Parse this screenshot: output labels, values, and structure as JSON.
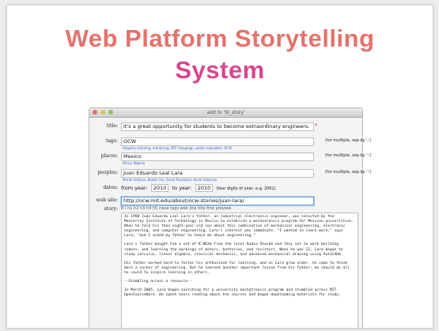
{
  "slide": {
    "title_line1": "Web Platform Storytelling",
    "title_line2": "System"
  },
  "window": {
    "title": "add to 'bl_story'"
  },
  "form": {
    "title": {
      "label": "title:",
      "value": "It's a great opportunity for students to become extraordinary engineers.",
      "required": "*"
    },
    "tags": {
      "label": "tags:",
      "value": "OCW",
      "hint": "Adaptive learning, mentoring, MIT Campaign, public education, OCW",
      "note": "(for multiple, sep by ';')"
    },
    "places": {
      "label": "places:",
      "value": "Mexico",
      "hint": "Africa, Nigeria",
      "note": "(for multiple, sep by ';')"
    },
    "peoples": {
      "label": "peoples:",
      "value": "Juan Eduardo Leal Lara",
      "hint": "Muriel Ambrus, Baldor rox, Sarah Randazzo, Kunle Adejumo",
      "note": "(for multiple, sep by ';')"
    },
    "dates": {
      "label": "dates:",
      "from_label": "from year:",
      "from": "2010",
      "to_label": "to year:",
      "to": "2010",
      "format": "(four digits of year, e.g. 2001)"
    },
    "website": {
      "label": "web site:",
      "value": "http://ocw.mit.edu/about/ocw-stories/juan-lara/"
    },
    "story": {
      "label": "story:",
      "toolbar": "B   I   h1   h2   h3   h4   h5   close tags   web   link   title   first   preview",
      "paragraphs": [
        "In 1990 Juan Eduardo Leal Lara's father, an industrial electronics engineer, was selected by the Monterrey Institute of Technology in Mexico to establish a mechatronics program for Mexican universities. When he told his then eight-year-old son about this combination of mechanical engineering, electronic engineering, and computer engineering, Lara's interest was immediate. \"I wanted to learn more,\" says Lara, \"and I asked my father to teach me about engineering.\"",
        "Lara's father bought him a set of K'NEX® from the local Radio Shack® and they set to work building robots, and learning the workings of motors, batteries, and resistors. When he was 12, Lara began to study calculus, linear algebra, classical mechanics, and advanced mechanical drawing using AutoCAD®.",
        "His father worked hard to foster his enthusiasm for learning, and as Lara grew older, he came to think more a career of engineering. But he learned another important lesson from his father: he should do all he could to inspire learning in others.",
        "--Stumbling across a resource--",
        "In March 2005, Lara began searching for a university mechatronics program and stumbled across MIT OpenCourseWare. He spent hours reading about the courses and began downloading materials for study."
      ]
    }
  }
}
